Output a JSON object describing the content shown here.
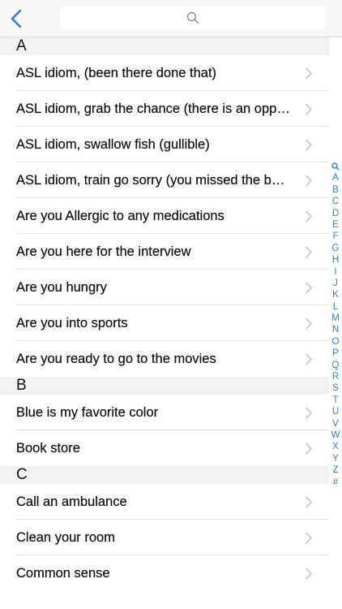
{
  "navbar": {
    "back_icon": "chevron-left-icon",
    "search": {
      "placeholder": "",
      "value": "",
      "icon": "search-icon"
    }
  },
  "colors": {
    "accent": "#2a7fe0",
    "section_bg": "#f2f2f2",
    "separator": "#e3e3e3"
  },
  "sections": [
    {
      "letter": "A",
      "items": [
        "ASL idiom, (been there done that)",
        "ASL idiom, grab the chance (there is an opportunity)",
        "ASL idiom, swallow fish (gullible)",
        "ASL idiom, train go sorry (you missed the boat)",
        "Are you Allergic to any medications",
        "Are you here for the interview",
        "Are you hungry",
        "Are you into sports",
        "Are you ready to go to the movies"
      ]
    },
    {
      "letter": "B",
      "items": [
        "Blue is my favorite color",
        "Book store"
      ]
    },
    {
      "letter": "C",
      "items": [
        "Call an ambulance",
        "Clean your room",
        "Common sense"
      ]
    }
  ],
  "index": [
    "A",
    "B",
    "C",
    "D",
    "E",
    "F",
    "G",
    "H",
    "I",
    "J",
    "K",
    "L",
    "M",
    "N",
    "O",
    "P",
    "Q",
    "R",
    "S",
    "T",
    "U",
    "V",
    "W",
    "X",
    "Y",
    "Z",
    "#"
  ]
}
